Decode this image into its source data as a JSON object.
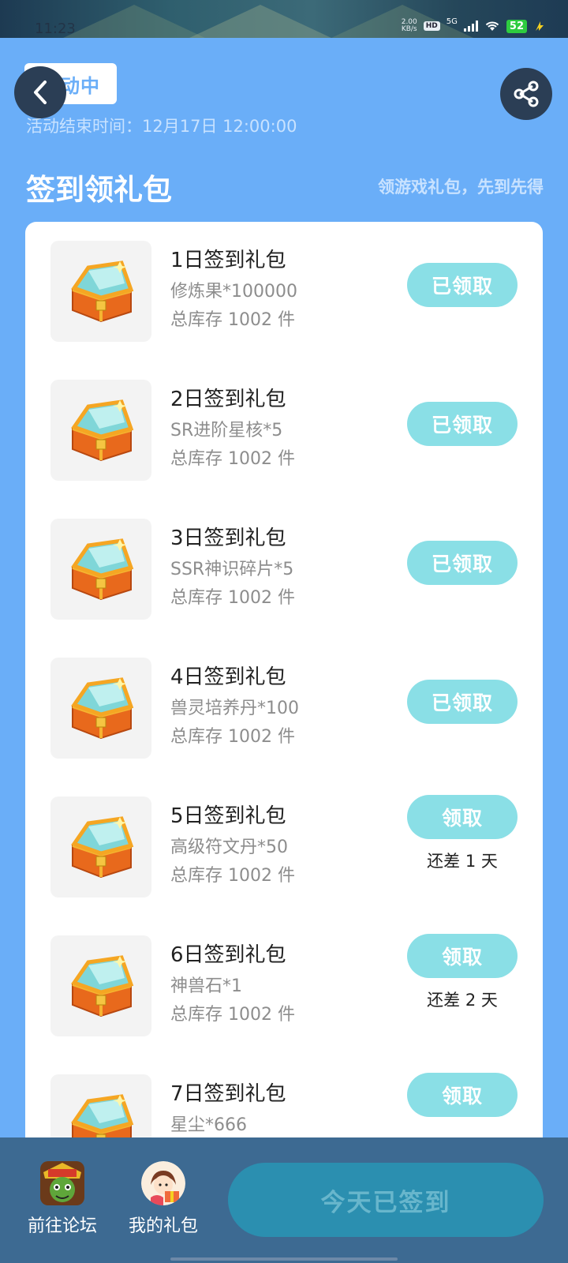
{
  "status_bar": {
    "time": "11:23",
    "net_speed_value": "2.00",
    "net_speed_unit": "KB/s",
    "hd_label": "HD",
    "network_label": "5G",
    "battery_level": "52",
    "icons": [
      "hd-icon",
      "signal-icon",
      "wifi-icon",
      "battery-icon",
      "charging-icon"
    ]
  },
  "header": {
    "status_pill": "活动中",
    "end_time_text": "活动结束时间：12月17日 12:00:00",
    "back_icon": "chevron-left-icon",
    "share_icon": "share-icon"
  },
  "section": {
    "title": "签到领礼包",
    "subtitle": "领游戏礼包，先到先得"
  },
  "gifts": [
    {
      "title": "1日签到礼包",
      "reward": "修炼果*100000",
      "stock": "总库存 1002 件",
      "button": "已领取",
      "note": ""
    },
    {
      "title": "2日签到礼包",
      "reward": "SR进阶星核*5",
      "stock": "总库存 1002 件",
      "button": "已领取",
      "note": ""
    },
    {
      "title": "3日签到礼包",
      "reward": "SSR神识碎片*5",
      "stock": "总库存 1002 件",
      "button": "已领取",
      "note": ""
    },
    {
      "title": "4日签到礼包",
      "reward": "兽灵培养丹*100",
      "stock": "总库存 1002 件",
      "button": "已领取",
      "note": ""
    },
    {
      "title": "5日签到礼包",
      "reward": "高级符文丹*50",
      "stock": "总库存 1002 件",
      "button": "领取",
      "note": "还差 1 天"
    },
    {
      "title": "6日签到礼包",
      "reward": "神兽石*1",
      "stock": "总库存 1002 件",
      "button": "领取",
      "note": "还差 2 天"
    },
    {
      "title": "7日签到礼包",
      "reward": "星尘*666",
      "stock": "",
      "button": "领取",
      "note": ""
    }
  ],
  "bottom_bar": {
    "forum_label": "前往论坛",
    "my_gifts_label": "我的礼包",
    "signed_label": "今天已签到"
  },
  "colors": {
    "page_bg": "#6aaef8",
    "claim_button": "#8adfe6",
    "bottom_bar": "#3d6a92",
    "signed_button": "#2b8fb0"
  }
}
